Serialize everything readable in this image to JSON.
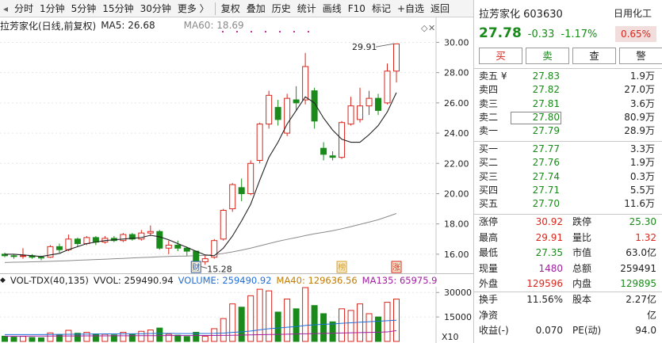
{
  "toolbar": {
    "items": [
      "分时",
      "1分钟",
      "5分钟",
      "15分钟",
      "30分钟",
      "更多 〉"
    ],
    "tools": [
      "复权",
      "叠加",
      "历史",
      "统计",
      "画线",
      "F10",
      "标记",
      "+自选",
      "返回"
    ]
  },
  "chart": {
    "title": "拉芳家化(日线,前复权)",
    "ma5": "MA5: 26.68",
    "ma60": "MA60: 18.69",
    "high_marker": "29.91",
    "low_marker": "15.28",
    "badges": [
      "财",
      "榜",
      "涨"
    ]
  },
  "volume": {
    "indicator": "VOL-TDX(40,135)",
    "vvol": "VVOL: 259490.94",
    "volume": "VOLUME: 259490.92",
    "ma40": "MA40: 129636.56",
    "ma135": "MA135: 65975.9",
    "x10": "X10"
  },
  "stock": {
    "name_code": "拉芳家化 603630",
    "industry": "日用化工",
    "price": "27.78",
    "change": "-0.33",
    "change_pct": "-1.17%",
    "industry_change": "0.65%"
  },
  "trade_buttons": [
    "买",
    "卖",
    "查",
    "警"
  ],
  "ask": [
    {
      "label": "卖五 ¥",
      "price": "27.83",
      "vol": "1.9万"
    },
    {
      "label": "卖四",
      "price": "27.82",
      "vol": "27.0万"
    },
    {
      "label": "卖三",
      "price": "27.81",
      "vol": "3.6万"
    },
    {
      "label": "卖二",
      "price": "27.80",
      "vol": "80.9万"
    },
    {
      "label": "卖一",
      "price": "27.79",
      "vol": "28.9万"
    }
  ],
  "bid": [
    {
      "label": "买一",
      "price": "27.77",
      "vol": "3.3万"
    },
    {
      "label": "买二",
      "price": "27.76",
      "vol": "1.9万"
    },
    {
      "label": "买三",
      "price": "27.74",
      "vol": "0.3万"
    },
    {
      "label": "买四",
      "price": "27.71",
      "vol": "5.5万"
    },
    {
      "label": "买五",
      "price": "27.70",
      "vol": "11.6万"
    }
  ],
  "stats1": [
    {
      "l1": "涨停",
      "v1": "30.92",
      "l2": "跌停",
      "v2": "25.30"
    },
    {
      "l1": "最高",
      "v1": "29.91",
      "l2": "量比",
      "v2": "1.32"
    },
    {
      "l1": "最低",
      "v1": "27.35",
      "l2": "市值",
      "v2": "63.0亿"
    },
    {
      "l1": "现量",
      "v1": "1480",
      "l2": "总额",
      "v2": "259491"
    },
    {
      "l1": "外盘",
      "v1": "129596",
      "l2": "内盘",
      "v2": "129895"
    }
  ],
  "stats2": [
    {
      "l1": "换手",
      "v1": "11.56%",
      "l2": "股本",
      "v2": "2.27亿"
    },
    {
      "l1": "净资",
      "v1": "",
      "l2": "",
      "v2": "亿"
    },
    {
      "l1": "收益(-)",
      "v1": "0.070",
      "l2": "PE(动)",
      "v2": "94.0"
    }
  ],
  "colors": {
    "up": "#d9261c",
    "down": "#1a8a1a",
    "ma5": "#222222",
    "ma60": "#8a8a8a"
  },
  "chart_data": {
    "type": "candlestick",
    "price_axis": {
      "ticks": [
        "30.00",
        "28.00",
        "26.00",
        "24.00",
        "22.00",
        "20.00",
        "18.00",
        "16.00"
      ],
      "ylim": [
        15.0,
        30.6
      ]
    },
    "volume_axis": {
      "ticks": [
        "30000",
        "15000"
      ],
      "unit": "X10",
      "ylim": [
        0,
        34000
      ]
    },
    "candles": [
      {
        "o": 16.0,
        "c": 15.9,
        "h": 16.1,
        "l": 15.8,
        "v": 3200
      },
      {
        "o": 15.9,
        "c": 15.85,
        "h": 16.0,
        "l": 15.7,
        "v": 2600
      },
      {
        "o": 15.85,
        "c": 15.9,
        "h": 16.4,
        "l": 15.7,
        "v": 3100
      },
      {
        "o": 15.9,
        "c": 15.8,
        "h": 16.0,
        "l": 15.7,
        "v": 2400
      },
      {
        "o": 15.8,
        "c": 15.75,
        "h": 15.9,
        "l": 15.6,
        "v": 2200
      },
      {
        "o": 15.8,
        "c": 16.5,
        "h": 16.6,
        "l": 15.75,
        "v": 5200
      },
      {
        "o": 16.5,
        "c": 16.3,
        "h": 16.7,
        "l": 16.1,
        "v": 4200
      },
      {
        "o": 16.3,
        "c": 17.0,
        "h": 17.3,
        "l": 16.2,
        "v": 6800
      },
      {
        "o": 17.0,
        "c": 16.7,
        "h": 17.1,
        "l": 16.5,
        "v": 5000
      },
      {
        "o": 16.7,
        "c": 17.1,
        "h": 17.2,
        "l": 16.6,
        "v": 5600
      },
      {
        "o": 17.1,
        "c": 16.8,
        "h": 17.2,
        "l": 16.6,
        "v": 4600
      },
      {
        "o": 16.8,
        "c": 17.05,
        "h": 17.2,
        "l": 16.7,
        "v": 4400
      },
      {
        "o": 17.05,
        "c": 16.9,
        "h": 17.2,
        "l": 16.8,
        "v": 4000
      },
      {
        "o": 16.9,
        "c": 17.3,
        "h": 17.4,
        "l": 16.8,
        "v": 5600
      },
      {
        "o": 17.3,
        "c": 17.0,
        "h": 17.4,
        "l": 16.9,
        "v": 4400
      },
      {
        "o": 17.0,
        "c": 17.4,
        "h": 17.6,
        "l": 16.9,
        "v": 6200
      },
      {
        "o": 17.4,
        "c": 17.5,
        "h": 17.9,
        "l": 17.2,
        "v": 7000
      },
      {
        "o": 17.5,
        "c": 16.4,
        "h": 17.6,
        "l": 16.3,
        "v": 8200
      },
      {
        "o": 16.4,
        "c": 16.6,
        "h": 16.9,
        "l": 16.0,
        "v": 4400
      },
      {
        "o": 16.6,
        "c": 16.4,
        "h": 16.9,
        "l": 16.2,
        "v": 3800
      },
      {
        "o": 16.4,
        "c": 16.2,
        "h": 16.5,
        "l": 15.9,
        "v": 3000
      },
      {
        "o": 16.2,
        "c": 15.5,
        "h": 16.2,
        "l": 15.28,
        "v": 5600
      },
      {
        "o": 15.5,
        "c": 15.7,
        "h": 15.9,
        "l": 15.3,
        "v": 3200
      },
      {
        "o": 15.8,
        "c": 16.9,
        "h": 17.0,
        "l": 15.7,
        "v": 7800
      },
      {
        "o": 17.0,
        "c": 18.9,
        "h": 19.0,
        "l": 16.9,
        "v": 14000
      },
      {
        "o": 19.0,
        "c": 20.6,
        "h": 20.7,
        "l": 18.8,
        "v": 23000
      },
      {
        "o": 20.4,
        "c": 20.0,
        "h": 21.0,
        "l": 19.5,
        "v": 21000
      },
      {
        "o": 20.0,
        "c": 22.0,
        "h": 22.2,
        "l": 19.9,
        "v": 28000
      },
      {
        "o": 22.2,
        "c": 24.6,
        "h": 24.7,
        "l": 22.0,
        "v": 32000
      },
      {
        "o": 24.6,
        "c": 26.5,
        "h": 26.8,
        "l": 24.3,
        "v": 31000
      },
      {
        "o": 25.7,
        "c": 24.9,
        "h": 26.2,
        "l": 24.5,
        "v": 18000
      },
      {
        "o": 24.0,
        "c": 26.3,
        "h": 26.6,
        "l": 23.8,
        "v": 26000
      },
      {
        "o": 26.2,
        "c": 26.0,
        "h": 27.1,
        "l": 25.5,
        "v": 20000
      },
      {
        "o": 26.2,
        "c": 28.4,
        "h": 29.3,
        "l": 25.9,
        "v": 33000
      },
      {
        "o": 26.8,
        "c": 24.8,
        "h": 27.0,
        "l": 24.3,
        "v": 22000
      },
      {
        "o": 23.0,
        "c": 22.6,
        "h": 23.4,
        "l": 22.2,
        "v": 17000
      },
      {
        "o": 22.5,
        "c": 22.4,
        "h": 22.8,
        "l": 22.2,
        "v": 12000
      },
      {
        "o": 22.4,
        "c": 24.7,
        "h": 24.8,
        "l": 22.3,
        "v": 20000
      },
      {
        "o": 24.6,
        "c": 25.8,
        "h": 26.4,
        "l": 24.5,
        "v": 19000
      },
      {
        "o": 24.9,
        "c": 25.8,
        "h": 27.0,
        "l": 24.7,
        "v": 23000
      },
      {
        "o": 25.8,
        "c": 26.3,
        "h": 26.8,
        "l": 25.2,
        "v": 17000
      },
      {
        "o": 26.3,
        "c": 25.5,
        "h": 26.6,
        "l": 25.2,
        "v": 15000
      },
      {
        "o": 26.0,
        "c": 28.1,
        "h": 28.6,
        "l": 25.9,
        "v": 24000
      },
      {
        "o": 28.1,
        "c": 29.9,
        "h": 29.91,
        "l": 27.35,
        "v": 25949
      }
    ],
    "ma5": [
      16.0,
      16.0,
      15.95,
      15.9,
      15.85,
      15.95,
      16.05,
      16.3,
      16.5,
      16.7,
      16.8,
      16.9,
      16.95,
      17.0,
      17.05,
      17.1,
      17.25,
      17.15,
      16.95,
      16.7,
      16.45,
      16.2,
      15.95,
      15.9,
      16.4,
      17.2,
      18.2,
      19.3,
      20.9,
      22.4,
      23.4,
      24.6,
      25.5,
      26.4,
      26.0,
      25.0,
      24.2,
      23.6,
      23.4,
      23.4,
      23.9,
      24.5,
      25.4,
      26.68
    ],
    "ma60": [
      15.45,
      15.47,
      15.48,
      15.5,
      15.51,
      15.53,
      15.55,
      15.57,
      15.6,
      15.62,
      15.65,
      15.67,
      15.7,
      15.72,
      15.75,
      15.78,
      15.8,
      15.83,
      15.85,
      15.87,
      15.88,
      15.9,
      15.92,
      15.97,
      16.05,
      16.15,
      16.27,
      16.4,
      16.55,
      16.7,
      16.85,
      16.98,
      17.1,
      17.23,
      17.35,
      17.45,
      17.55,
      17.68,
      17.82,
      17.97,
      18.12,
      18.28,
      18.48,
      18.69
    ],
    "vol_ma40": [
      4200,
      4200,
      4200,
      4200,
      4200,
      4250,
      4300,
      4400,
      4450,
      4500,
      4550,
      4600,
      4600,
      4650,
      4700,
      4750,
      4850,
      4900,
      4900,
      4850,
      4800,
      4850,
      4850,
      4900,
      5100,
      5500,
      5900,
      6400,
      7100,
      7800,
      8200,
      8700,
      9100,
      9800,
      10200,
      10500,
      10700,
      11100,
      11400,
      11800,
      12100,
      12400,
      12700,
      12964
    ],
    "vol_ma135": [
      3200,
      3220,
      3240,
      3260,
      3280,
      3300,
      3320,
      3340,
      3360,
      3380,
      3400,
      3420,
      3440,
      3460,
      3480,
      3500,
      3520,
      3550,
      3570,
      3580,
      3590,
      3610,
      3620,
      3650,
      3700,
      3790,
      3880,
      3980,
      4100,
      4230,
      4330,
      4450,
      4560,
      4700,
      4820,
      4930,
      5020,
      5150,
      5270,
      5400,
      5510,
      5630,
      5800,
      6598
    ]
  }
}
